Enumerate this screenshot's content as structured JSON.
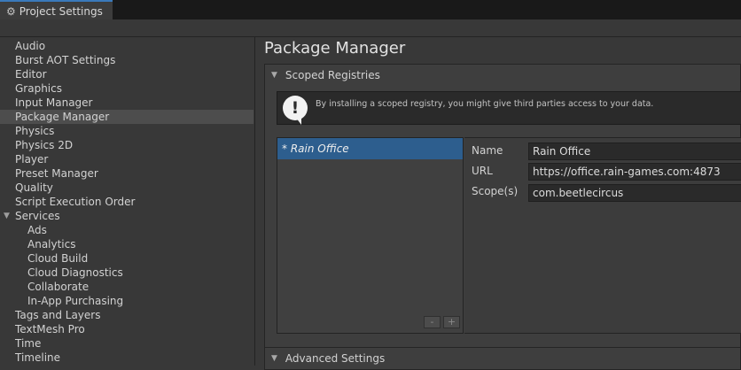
{
  "window": {
    "tab_title": "Project Settings",
    "tab_icon": "gear-icon"
  },
  "sidebar": {
    "items": [
      {
        "label": "Audio"
      },
      {
        "label": "Burst AOT Settings"
      },
      {
        "label": "Editor"
      },
      {
        "label": "Graphics"
      },
      {
        "label": "Input Manager"
      },
      {
        "label": "Package Manager",
        "selected": true
      },
      {
        "label": "Physics"
      },
      {
        "label": "Physics 2D"
      },
      {
        "label": "Player"
      },
      {
        "label": "Preset Manager"
      },
      {
        "label": "Quality"
      },
      {
        "label": "Script Execution Order"
      },
      {
        "label": "Services",
        "expanded": true
      },
      {
        "label": "Ads",
        "indent": 1
      },
      {
        "label": "Analytics",
        "indent": 1
      },
      {
        "label": "Cloud Build",
        "indent": 1
      },
      {
        "label": "Cloud Diagnostics",
        "indent": 1
      },
      {
        "label": "Collaborate",
        "indent": 1
      },
      {
        "label": "In-App Purchasing",
        "indent": 1
      },
      {
        "label": "Tags and Layers"
      },
      {
        "label": "TextMesh Pro"
      },
      {
        "label": "Time"
      },
      {
        "label": "Timeline"
      }
    ]
  },
  "main": {
    "title": "Package Manager",
    "scoped_registries": {
      "header": "Scoped Registries",
      "help_text": "By installing a scoped registry, you might give third parties access to your data.",
      "registries": [
        {
          "label": "* Rain Office",
          "selected": true
        }
      ],
      "add_label": "+",
      "remove_label": "-",
      "fields": {
        "name_label": "Name",
        "name_value": "Rain Office",
        "url_label": "URL",
        "url_value": "https://office.rain-games.com:4873",
        "scope_label": "Scope(s)",
        "scope_value": "com.beetlecircus"
      }
    },
    "advanced_settings": {
      "header": "Advanced Settings"
    }
  },
  "colors": {
    "selection": "#2d5e8e",
    "tab_accent": "#3a79bb"
  }
}
